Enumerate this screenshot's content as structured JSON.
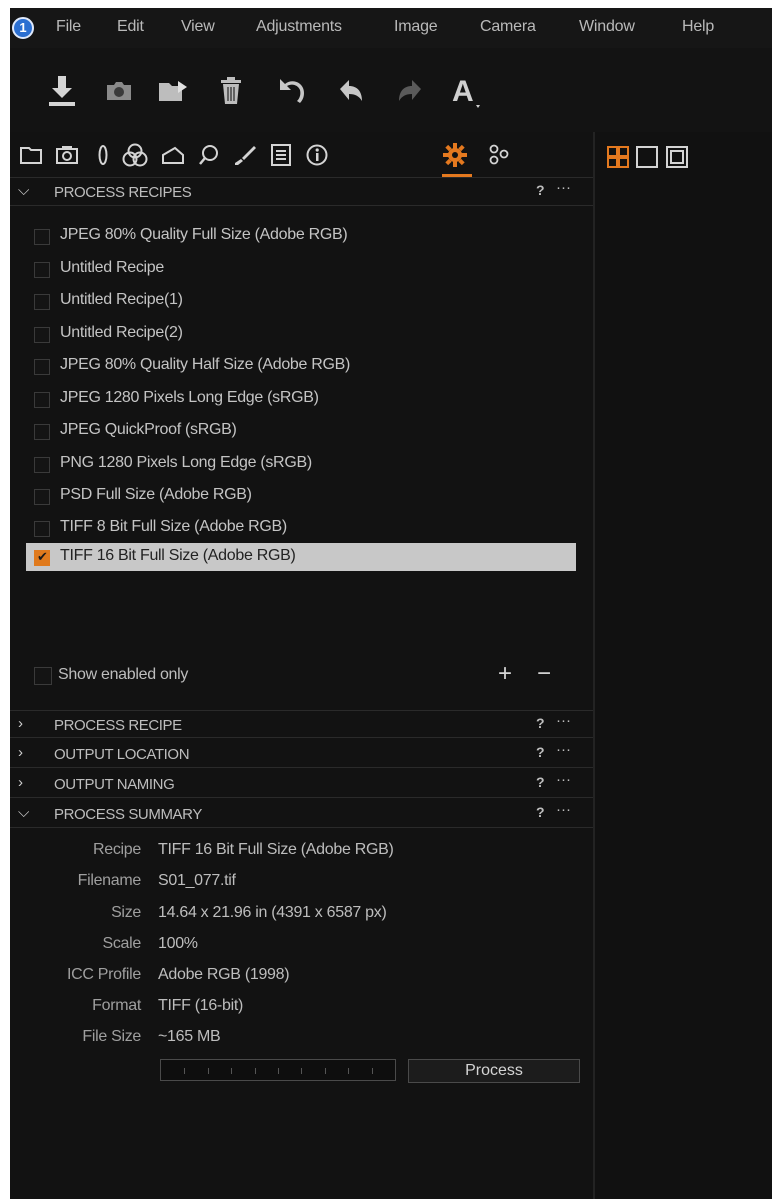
{
  "menubar": {
    "items": [
      "File",
      "Edit",
      "View",
      "Adjustments",
      "Image",
      "Camera",
      "Window",
      "Help"
    ]
  },
  "toolbar": {
    "icons": [
      "import-icon",
      "camera-icon",
      "folder-icon",
      "trash-icon",
      "undo-all-icon",
      "undo-icon",
      "redo-icon",
      "text-tool-icon"
    ]
  },
  "tool_tabs": {
    "icons": [
      "library-icon",
      "capture-icon",
      "lens-icon",
      "color-icon",
      "exposure-icon",
      "details-icon",
      "adjustments-icon",
      "metadata-icon",
      "info-icon",
      "output-icon",
      "batch-icon"
    ],
    "active_index": 9
  },
  "view_buttons": [
    "grid-view-icon",
    "single-view-icon",
    "fullscreen-view-icon"
  ],
  "sections": {
    "process_recipes": "PROCESS RECIPES",
    "process_recipe": "PROCESS RECIPE",
    "output_location": "OUTPUT LOCATION",
    "output_naming": "OUTPUT NAMING",
    "process_summary": "PROCESS SUMMARY",
    "help": "?",
    "more": "···"
  },
  "recipes": [
    {
      "label": "JPEG 80% Quality Full Size (Adobe RGB)",
      "checked": false
    },
    {
      "label": "Untitled Recipe",
      "checked": false
    },
    {
      "label": "Untitled Recipe(1)",
      "checked": false
    },
    {
      "label": "Untitled Recipe(2)",
      "checked": false
    },
    {
      "label": "JPEG 80% Quality Half Size (Adobe RGB)",
      "checked": false
    },
    {
      "label": "JPEG 1280 Pixels Long Edge (sRGB)",
      "checked": false
    },
    {
      "label": "JPEG QuickProof (sRGB)",
      "checked": false
    },
    {
      "label": "PNG 1280 Pixels Long Edge (sRGB)",
      "checked": false
    },
    {
      "label": "PSD Full Size (Adobe RGB)",
      "checked": false
    },
    {
      "label": "TIFF 8 Bit Full Size (Adobe RGB)",
      "checked": false
    },
    {
      "label": "TIFF 16 Bit Full Size (Adobe RGB)",
      "checked": true
    }
  ],
  "show_enabled_only": {
    "label": "Show enabled only",
    "checked": false
  },
  "recipe_actions": {
    "add": "+",
    "remove": "−"
  },
  "summary": [
    {
      "key": "Recipe",
      "value": "TIFF 16 Bit Full Size (Adobe RGB)"
    },
    {
      "key": "Filename",
      "value": "S01_077.tif"
    },
    {
      "key": "Size",
      "value": "14.64 x 21.96 in (4391 x 6587 px)"
    },
    {
      "key": "Scale",
      "value": "100%"
    },
    {
      "key": "ICC Profile",
      "value": "Adobe RGB (1998)"
    },
    {
      "key": "Format",
      "value": "TIFF (16-bit)"
    },
    {
      "key": "File Size",
      "value": "~165 MB"
    }
  ],
  "process": {
    "button_label": "Process",
    "progress": 0
  },
  "colors": {
    "accent": "#e4791f",
    "background": "#121212",
    "selected_row": "#c8c8c8"
  }
}
